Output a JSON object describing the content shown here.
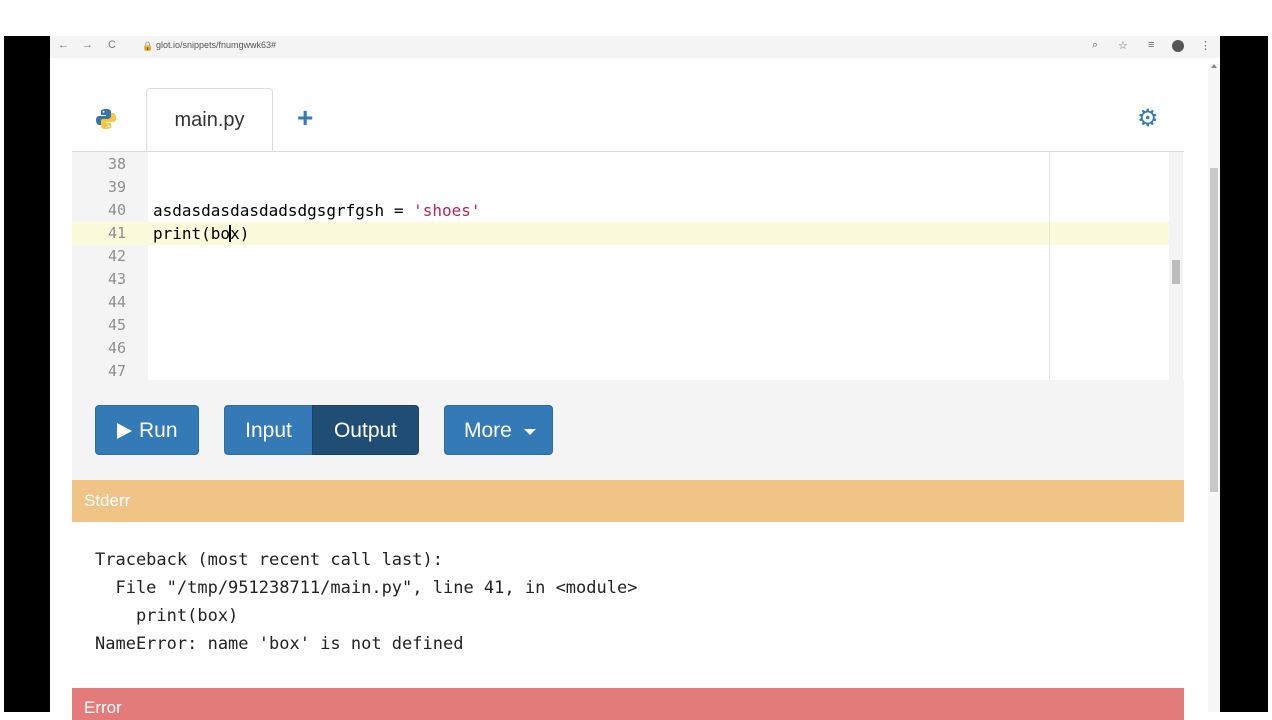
{
  "browser": {
    "back": "←",
    "forward": "→",
    "reload": "C",
    "url": "glot.io/snippets/fnumgwwk63#",
    "zoom_icon": "zoom-icon",
    "star_icon": "star-icon",
    "playlist_icon": "playlist-icon",
    "menu": "⋮"
  },
  "tabs": [
    {
      "label": "main.py",
      "active": true
    }
  ],
  "add_file_label": "+",
  "editor": {
    "line_numbers": [
      "38",
      "39",
      "40",
      "41",
      "42",
      "43",
      "44",
      "45",
      "46",
      "47"
    ],
    "active_line": "41",
    "line40": {
      "code": "asdasdasdasdadsdgsgrfgsh = ",
      "string": "'shoes'"
    },
    "line41": {
      "before_cursor": "print(bo",
      "after_cursor": "x)"
    }
  },
  "buttons": {
    "run": "Run",
    "input": "Input",
    "output": "Output",
    "more": "More"
  },
  "stderr": {
    "title": "Stderr",
    "lines": [
      "Traceback (most recent call last):",
      "  File \"/tmp/951238711/main.py\", line 41, in <module>",
      "    print(box)",
      "NameError: name 'box' is not defined"
    ]
  },
  "error": {
    "title": "Error"
  },
  "colors": {
    "primary": "#337ab7",
    "primary_active": "#204d74",
    "stderr_bar": "#f0c386",
    "error_bar": "#e47b7b",
    "string": "#b5275a",
    "active_line": "#fbfbdc"
  }
}
